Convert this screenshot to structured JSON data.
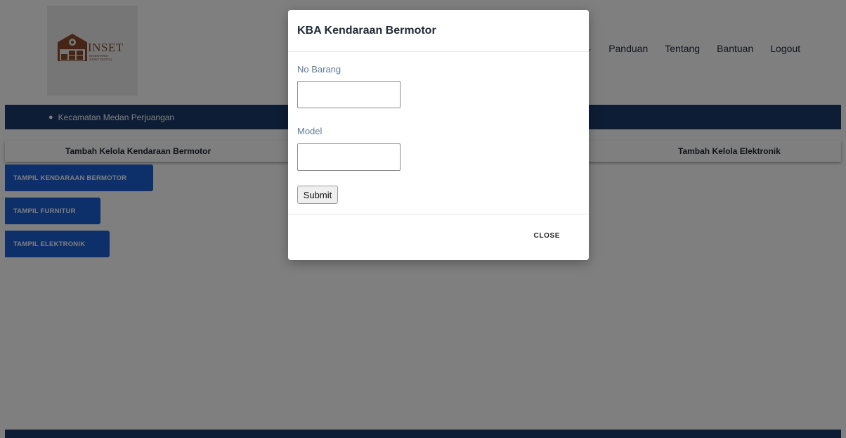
{
  "header": {
    "logo": {
      "text": "INSET",
      "subtext": "INVENTARIS ASSET DIGITAL"
    },
    "nav": {
      "dropdown_partial": "n",
      "items": [
        "Panduan",
        "Tentang",
        "Bantuan",
        "Logout"
      ]
    }
  },
  "location": {
    "icon": "map-pin-icon",
    "text": "Kecamatan Medan Perjuangan"
  },
  "tabs": {
    "left": "Tambah Kelola Kendaraan Bermotor",
    "right": "Tambah Kelola Elektronik"
  },
  "side_buttons": {
    "kendaraan": "TAMPIL KENDARAAN BERMOTOR",
    "furnitur": "TAMPIL FURNITUR",
    "elektronik": "TAMPIL ELEKTRONIK"
  },
  "modal": {
    "title": "KBA Kendaraan Bermotor",
    "fields": {
      "no_barang": {
        "label": "No Barang",
        "value": ""
      },
      "model": {
        "label": "Model",
        "value": ""
      }
    },
    "submit_label": "Submit",
    "close_label": "CLOSE"
  },
  "colors": {
    "primary_blue": "#1b61d6",
    "navy_bar": "#1a3a6b",
    "logo_brown": "#8a4a2c"
  }
}
